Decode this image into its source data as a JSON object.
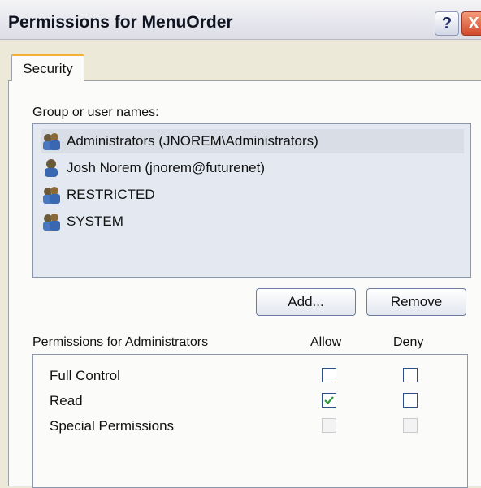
{
  "window": {
    "title": "Permissions for MenuOrder",
    "help_glyph": "?",
    "close_glyph": "X"
  },
  "tabs": [
    {
      "label": "Security",
      "active": true
    }
  ],
  "group_section": {
    "label": "Group or user names:",
    "users": [
      {
        "name": "Administrators (JNOREM\\Administrators)",
        "icon": "group-icon",
        "selected": true
      },
      {
        "name": "Josh Norem (jnorem@futurenet)",
        "icon": "user-icon",
        "selected": false
      },
      {
        "name": "RESTRICTED",
        "icon": "group-icon",
        "selected": false
      },
      {
        "name": "SYSTEM",
        "icon": "group-icon",
        "selected": false
      }
    ]
  },
  "buttons": {
    "add": "Add...",
    "remove": "Remove"
  },
  "permissions": {
    "label": "Permissions for Administrators",
    "allow_header": "Allow",
    "deny_header": "Deny",
    "rows": [
      {
        "name": "Full Control",
        "allow": false,
        "deny": false,
        "enabled": true
      },
      {
        "name": "Read",
        "allow": true,
        "deny": false,
        "enabled": true
      },
      {
        "name": "Special Permissions",
        "allow": false,
        "deny": false,
        "enabled": false
      }
    ]
  },
  "colors": {
    "selection": "#d9dde6",
    "check": "#2a9a3a",
    "tab_accent": "#f2b23a"
  }
}
